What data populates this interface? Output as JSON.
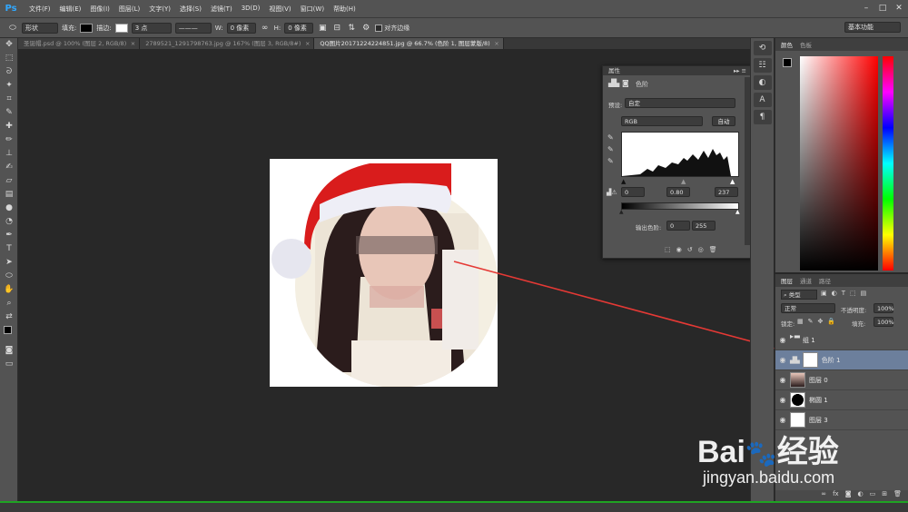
{
  "app_logo": "Ps",
  "menu": [
    "文件(F)",
    "编辑(E)",
    "图像(I)",
    "图层(L)",
    "文字(Y)",
    "选择(S)",
    "滤镜(T)",
    "3D(D)",
    "视图(V)",
    "窗口(W)",
    "帮助(H)"
  ],
  "options": {
    "shape_mode": "形状",
    "fill_label": "填充:",
    "stroke_label": "描边:",
    "stroke_size": "3 点",
    "w_label": "W:",
    "w_value": "0 像素",
    "h_label": "H:",
    "h_value": "0 像素",
    "align_edges": "对齐边缘",
    "workspace": "基本功能"
  },
  "tabs": [
    {
      "label": "圣诞帽.psd @ 100% (图层 2, RGB/8)",
      "active": false
    },
    {
      "label": "2789521_1291798763.jpg @ 167% (图层 3, RGB/8#)",
      "active": false
    },
    {
      "label": "QQ图片20171224224851.jpg @ 66.7% (色阶 1, 图层蒙版/8)",
      "active": true
    }
  ],
  "properties": {
    "title": "属性",
    "adjustment": "色阶",
    "preset_label": "预设:",
    "preset_value": "自定",
    "channel": "RGB",
    "auto_button": "自动",
    "input_black": "0",
    "input_gamma": "0.80",
    "input_white": "237",
    "output_label": "输出色阶:",
    "output_black": "0",
    "output_white": "255"
  },
  "color_panel": {
    "tabs": [
      "颜色",
      "色板"
    ]
  },
  "layers_panel": {
    "tabs": [
      "图层",
      "通道",
      "路径"
    ],
    "filter": "类型",
    "blend_mode": "正常",
    "opacity_label": "不透明度:",
    "opacity_value": "100%",
    "lock_label": "锁定:",
    "fill_label": "填充:",
    "fill_value": "100%",
    "layers": [
      {
        "name": "组 1",
        "type": "group",
        "selected": false
      },
      {
        "name": "色阶 1",
        "type": "adjustment",
        "selected": true
      },
      {
        "name": "图层 0",
        "type": "photo",
        "selected": false
      },
      {
        "name": "椭圆 1",
        "type": "shape",
        "selected": false
      },
      {
        "name": "图层 3",
        "type": "white",
        "selected": false
      }
    ]
  },
  "watermark": {
    "brand": "Bai",
    "brand2": "经验",
    "url": "jingyan.baidu.com"
  },
  "colors": {
    "accent_arrow": "#e53935",
    "panel_bg": "#535353",
    "selection": "#6c7f9c",
    "hat_red": "#d91c1c"
  }
}
